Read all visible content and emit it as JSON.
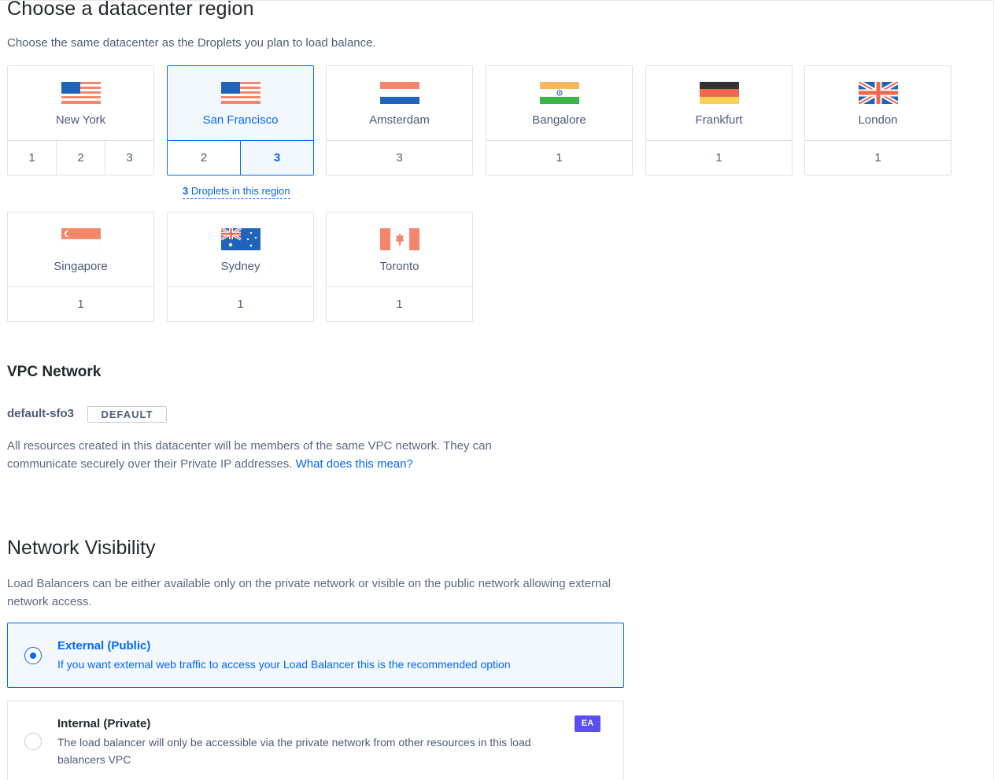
{
  "header": {
    "title": "Choose a datacenter region",
    "subtitle": "Choose the same datacenter as the Droplets you plan to load balance."
  },
  "regions": [
    {
      "name": "New York",
      "flag": "flag-us",
      "numbers": [
        "1",
        "2",
        "3"
      ],
      "selected": false,
      "active": ""
    },
    {
      "name": "San Francisco",
      "flag": "flag-us",
      "numbers": [
        "2",
        "3"
      ],
      "selected": true,
      "active": "3"
    },
    {
      "name": "Amsterdam",
      "flag": "flag-nl",
      "numbers": [
        "3"
      ],
      "selected": false,
      "active": ""
    },
    {
      "name": "Bangalore",
      "flag": "flag-in",
      "numbers": [
        "1"
      ],
      "selected": false,
      "active": ""
    },
    {
      "name": "Frankfurt",
      "flag": "flag-de",
      "numbers": [
        "1"
      ],
      "selected": false,
      "active": ""
    },
    {
      "name": "London",
      "flag": "flag-gb",
      "numbers": [
        "1"
      ],
      "selected": false,
      "active": ""
    },
    {
      "name": "Singapore",
      "flag": "flag-sg",
      "numbers": [
        "1"
      ],
      "selected": false,
      "active": ""
    },
    {
      "name": "Sydney",
      "flag": "flag-au",
      "numbers": [
        "1"
      ],
      "selected": false,
      "active": ""
    },
    {
      "name": "Toronto",
      "flag": "flag-ca",
      "numbers": [
        "1"
      ],
      "selected": false,
      "active": ""
    }
  ],
  "droplets_link": {
    "count": "3",
    "text": "Droplets in this region"
  },
  "vpc": {
    "title": "VPC Network",
    "name": "default-sfo3",
    "badge": "DEFAULT",
    "description": "All resources created in this datacenter will be members of the same VPC network. They can communicate securely over their Private IP addresses.",
    "link": "What does this mean?"
  },
  "visibility": {
    "title": "Network Visibility",
    "description": "Load Balancers can be either available only on the private network or visible on the public network allowing external network access.",
    "options": [
      {
        "title": "External (Public)",
        "description": "If you want external web traffic to access your Load Balancer this is the recommended option",
        "selected": true
      },
      {
        "title": "Internal (Private)",
        "description": "The load balancer will only be accessible via the private network from other resources in this load balancers VPC",
        "selected": false,
        "badge": "EA"
      }
    ]
  },
  "colors": {
    "accent": "#0069ff",
    "selected_bg": "#f3f8ff",
    "ea_badge": "#5b4ff0"
  }
}
